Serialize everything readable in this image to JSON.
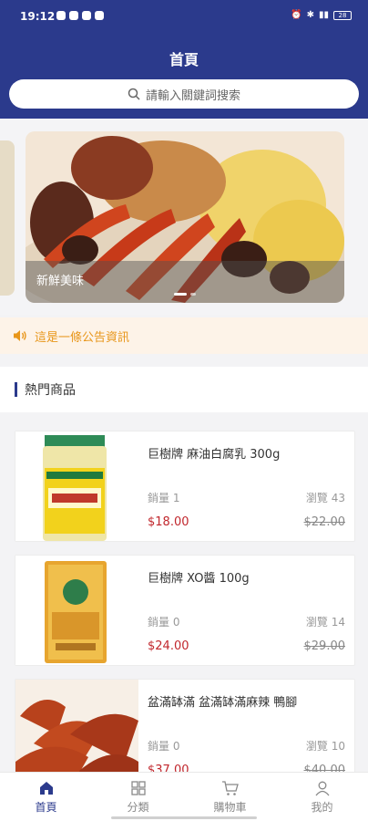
{
  "status_bar": {
    "time": "19:12",
    "battery": "28"
  },
  "header": {
    "title": "首頁",
    "search_placeholder": "請輸入關鍵詞搜索"
  },
  "banner": {
    "caption": "新鮮美味"
  },
  "notice": {
    "text": "這是一條公告資訊"
  },
  "section": {
    "title": "熱門商品"
  },
  "products": [
    {
      "name": "巨樹牌 麻油白腐乳 300g",
      "sales": "銷量 1",
      "views": "瀏覽 43",
      "price": "$18.00",
      "original_price": "$22.00"
    },
    {
      "name": "巨樹牌 XO醬 100g",
      "sales": "銷量 0",
      "views": "瀏覽 14",
      "price": "$24.00",
      "original_price": "$29.00"
    },
    {
      "name": "盆滿缽滿 盆滿缽滿麻辣 鴨腳",
      "sales": "銷量 0",
      "views": "瀏覽 10",
      "price": "$37.00",
      "original_price": "$40.00"
    }
  ],
  "tabbar": {
    "home": "首頁",
    "category": "分類",
    "cart": "購物車",
    "mine": "我的"
  },
  "colors": {
    "brand": "#2b3a8c",
    "price": "#c1272d",
    "notice": "#e8961a"
  }
}
